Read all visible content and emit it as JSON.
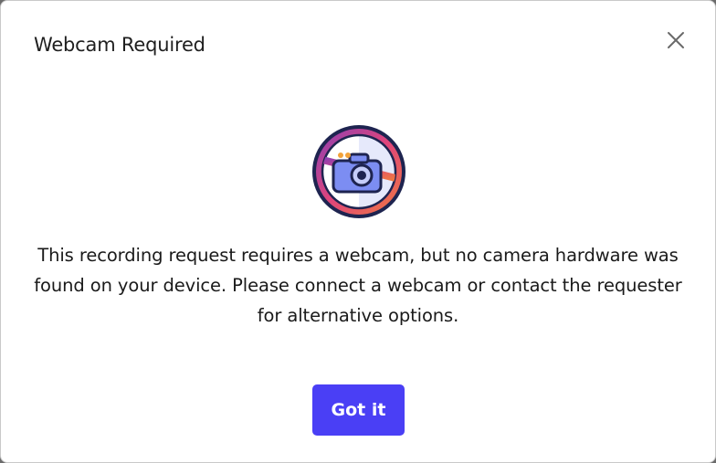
{
  "dialog": {
    "title": "Webcam Required",
    "close_icon": "close-icon",
    "illustration_icon": "no-camera-icon",
    "message": "This recording request requires a webcam, but no camera hardware was found on your device. Please connect a webcam or contact the requester for alternative options.",
    "primary_button_label": "Got it"
  },
  "colors": {
    "accent": "#4a3ff5",
    "dialog_background": "#ffffff",
    "text": "#1a1a1a"
  }
}
